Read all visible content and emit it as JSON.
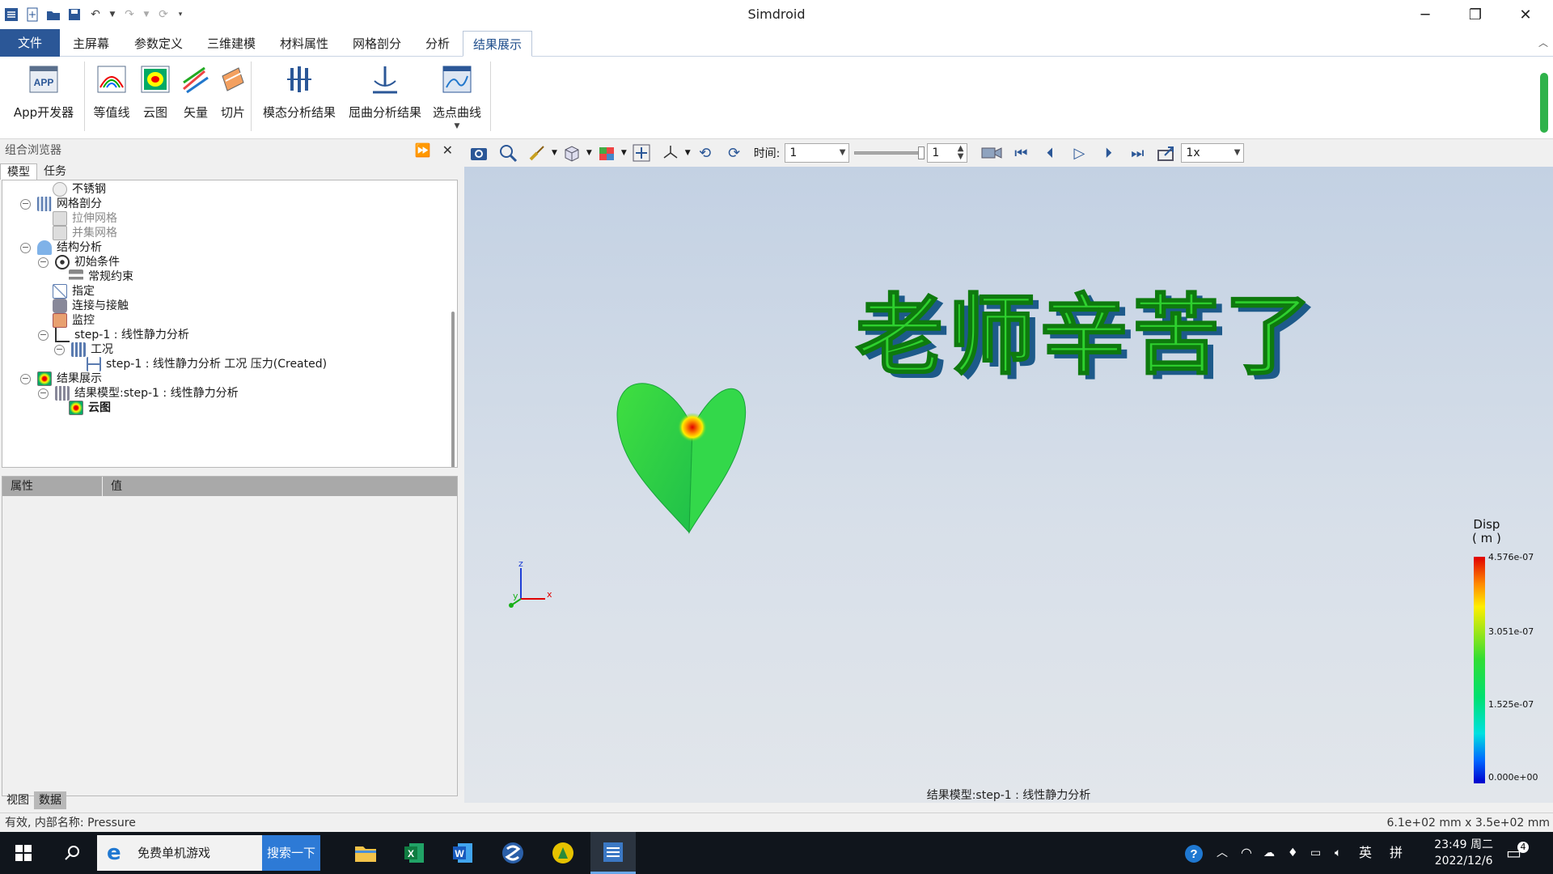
{
  "app": {
    "title": "Simdroid"
  },
  "menu": {
    "file": "文件",
    "tabs": [
      "主屏幕",
      "参数定义",
      "三维建模",
      "材料属性",
      "网格剖分",
      "分析",
      "结果展示"
    ],
    "active_tab": "结果展示"
  },
  "ribbon": {
    "buttons": [
      "App开发器",
      "等值线",
      "云图",
      "矢量",
      "切片",
      "模态分析结果",
      "屈曲分析结果",
      "选点曲线"
    ]
  },
  "browser": {
    "title": "组合浏览器",
    "tabs": [
      "模型",
      "任务"
    ],
    "tree": [
      {
        "label": "不锈钢",
        "level": 2
      },
      {
        "label": "网格剖分",
        "level": 0
      },
      {
        "label": "拉伸网格",
        "level": 1
      },
      {
        "label": "并集网格",
        "level": 1
      },
      {
        "label": "结构分析",
        "level": 0
      },
      {
        "label": "初始条件",
        "level": 1
      },
      {
        "label": "常规约束",
        "level": 2
      },
      {
        "label": "指定",
        "level": 1
      },
      {
        "label": "连接与接触",
        "level": 1
      },
      {
        "label": "监控",
        "level": 1
      },
      {
        "label": "step-1 : 线性静力分析",
        "level": 1
      },
      {
        "label": "工况",
        "level": 2
      },
      {
        "label": "step-1 : 线性静力分析 工况 压力(Created)",
        "level": 3
      },
      {
        "label": "结果展示",
        "level": 0
      },
      {
        "label": "结果模型:step-1 : 线性静力分析",
        "level": 1
      },
      {
        "label": "云图",
        "level": 2
      }
    ],
    "props_header": [
      "属性",
      "值"
    ],
    "bottom_tabs": [
      "视图",
      "数据"
    ]
  },
  "viewport_toolbar": {
    "time_label": "时间:",
    "time_value": "1",
    "step_value": "1",
    "speed": "1x"
  },
  "viewport": {
    "caption": "结果模型:step-1 : 线性静力分析",
    "model_text": "老师辛苦了",
    "legend": {
      "title": "Disp",
      "unit": "( m )",
      "ticks": [
        "4.576e-07",
        "3.051e-07",
        "1.525e-07",
        "0.000e+00"
      ],
      "max": 4.576e-07,
      "min": 0.0
    },
    "axes": {
      "x": "x",
      "y": "y",
      "z": "z"
    }
  },
  "status": {
    "left": "有效, 内部名称: Pressure",
    "right": "6.1e+02 mm x 3.5e+02 mm"
  },
  "taskbar": {
    "search_text": "免费单机游戏",
    "search_button": "搜索一下",
    "ime": "英",
    "ime2": "拼",
    "time": "23:49 周二",
    "date": "2022/12/6",
    "notification_count": "4"
  },
  "colors": {
    "accent": "#2b5797",
    "model_green": "#22cc22",
    "hotspot": "#e00000"
  }
}
